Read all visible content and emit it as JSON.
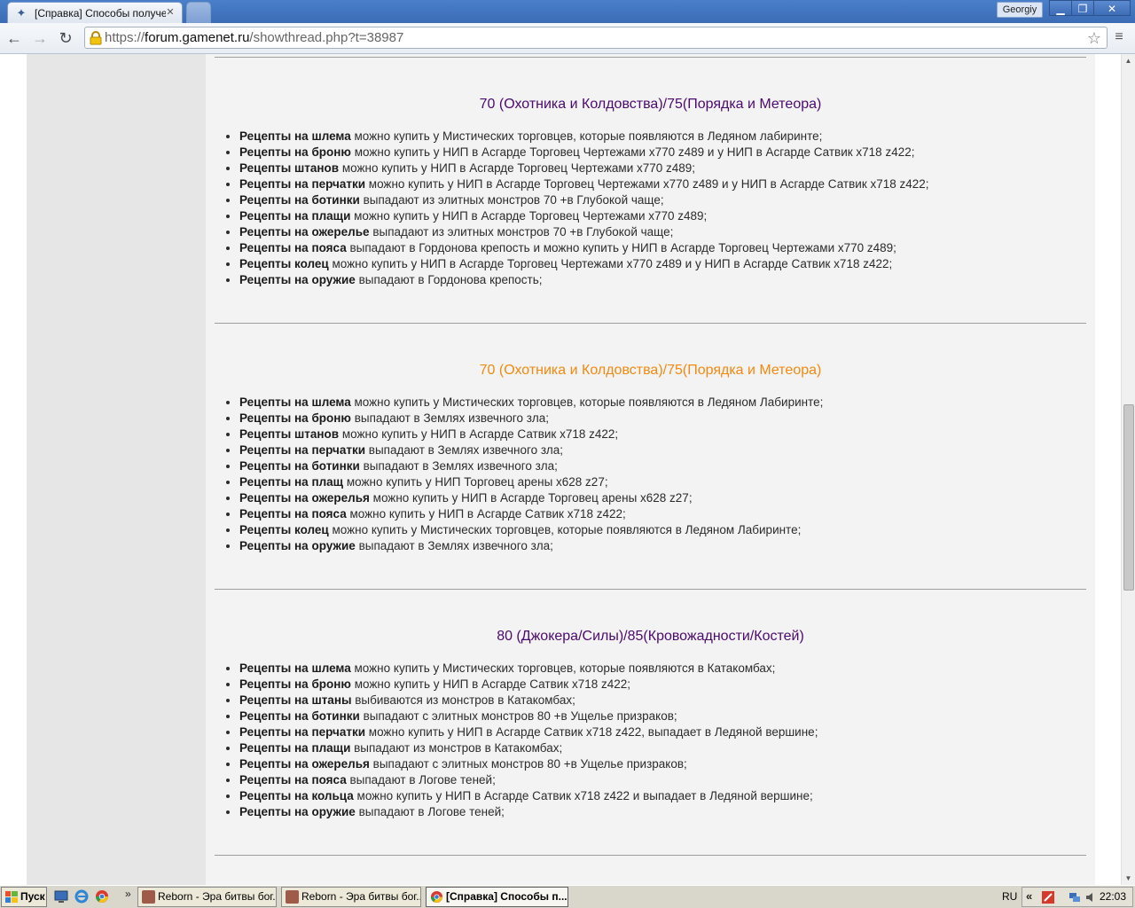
{
  "browser": {
    "tab_title": "[Справка] Способы получе",
    "user_name": "Georgiy",
    "url_scheme": "https://",
    "url_host": "forum.gamenet.ru",
    "url_path": "/showthread.php?t=38987"
  },
  "sections": [
    {
      "title": "70 (Охотника и Колдовства)/75(Порядка и Метеора)",
      "title_color": "#4b0a6e",
      "items": [
        {
          "bold": "Рецепты на шлема",
          "text": " можно купить у Мистических торговцев, которые появляются в Ледяном лабиринте;"
        },
        {
          "bold": "Рецепты на броню",
          "text": " можно купить у НИП в Асгарде Торговец Чертежами x770 z489 и у НИП в Асгарде Сатвик x718 z422;"
        },
        {
          "bold": "Рецепты штанов",
          "text": " можно купить у НИП в Асгарде Торговец Чертежами x770 z489;"
        },
        {
          "bold": "Рецепты на перчатки",
          "text": " можно купить у НИП в Асгарде Торговец Чертежами x770 z489 и у НИП в Асгарде Сатвик x718 z422;"
        },
        {
          "bold": "Рецепты на ботинки",
          "text": " выпадают из элитных монстров 70 +в Глубокой чаще;"
        },
        {
          "bold": "Рецепты на плащи",
          "text": " можно купить у НИП в Асгарде Торговец Чертежами x770 z489;"
        },
        {
          "bold": "Рецепты на ожерелье",
          "text": " выпадают из элитных монстров 70 +в Глубокой чаще;"
        },
        {
          "bold": "Рецепты на пояса",
          "text": " выпадают в Гордонова крепость и можно купить у НИП в Асгарде Торговец Чертежами x770 z489;"
        },
        {
          "bold": "Рецепты колец",
          "text": " можно купить у НИП в Асгарде Торговец Чертежами x770 z489 и у НИП в Асгарде Сатвик x718 z422;"
        },
        {
          "bold": "Рецепты на оружие",
          "text": " выпадают в Гордонова крепость;"
        }
      ]
    },
    {
      "title": "70 (Охотника и Колдовства)/75(Порядка и Метеора)",
      "title_color": "#f08a10",
      "items": [
        {
          "bold": "Рецепты на шлема",
          "text": " можно купить у Мистических торговцев, которые появляются в Ледяном Лабиринте;"
        },
        {
          "bold": "Рецепты на броню",
          "text": " выпадают в Землях извечного зла;"
        },
        {
          "bold": "Рецепты штанов",
          "text": " можно купить у НИП в Асгарде Сатвик x718 z422;"
        },
        {
          "bold": "Рецепты на перчатки",
          "text": " выпадают в Землях извечного зла;"
        },
        {
          "bold": "Рецепты на ботинки",
          "text": " выпадают в Землях извечного зла;"
        },
        {
          "bold": "Рецепты на плащ",
          "text": " можно купить у НИП Торговец арены x628 z27;"
        },
        {
          "bold": "Рецепты на ожерелья",
          "text": " можно купить у НИП в Асгарде Торговец арены x628 z27;"
        },
        {
          "bold": "Рецепты на пояса",
          "text": " можно купить у НИП в Асгарде Сатвик x718 z422;"
        },
        {
          "bold": "Рецепты колец",
          "text": " можно купить у Мистических торговцев, которые появляются в Ледяном Лабиринте;"
        },
        {
          "bold": "Рецепты на оружие",
          "text": " выпадают в Землях извечного зла;"
        }
      ]
    },
    {
      "title": "80 (Джокера/Силы)/85(Кровожадности/Костей)",
      "title_color": "#4b0a6e",
      "items": [
        {
          "bold": "Рецепты на шлема",
          "text": " можно купить у Мистических торговцев, которые появляются в Катакомбах;"
        },
        {
          "bold": "Рецепты на броню",
          "text": " можно купить у НИП в Асгарде Сатвик x718 z422;"
        },
        {
          "bold": "Рецепты на штаны",
          "text": " выбиваются из монстров в Катакомбах;"
        },
        {
          "bold": "Рецепты на ботинки",
          "text": " выпадают с элитных монстров 80 +в Ущелье призраков;"
        },
        {
          "bold": "Рецепты на перчатки",
          "text": " можно купить у НИП в Асгарде Сатвик x718 z422, выпадает в Ледяной вершине;"
        },
        {
          "bold": "Рецепты на плащи",
          "text": " выпадают из монстров в Катакомбах;"
        },
        {
          "bold": "Рецепты на ожерелья",
          "text": " выпадают с элитных монстров 80 +в Ущелье призраков;"
        },
        {
          "bold": "Рецепты на пояса",
          "text": " выпадают в Логове теней;"
        },
        {
          "bold": "Рецепты на кольца",
          "text": " можно купить у НИП в Асгарде Сатвик x718 z422 и выпадает в Ледяной вершине;"
        },
        {
          "bold": "Рецепты на оружие",
          "text": " выпадают в Логове теней;"
        }
      ]
    }
  ],
  "taskbar": {
    "start_label": "Пуск",
    "quicklaunch_more": "»",
    "tasks": [
      {
        "label": "Reborn - Эра битвы бог...",
        "active": false
      },
      {
        "label": "Reborn - Эра битвы бог...",
        "active": false
      },
      {
        "label": "[Справка] Способы п...",
        "active": true
      }
    ],
    "language": "RU",
    "tray_expand": "«",
    "clock": "22:03"
  }
}
